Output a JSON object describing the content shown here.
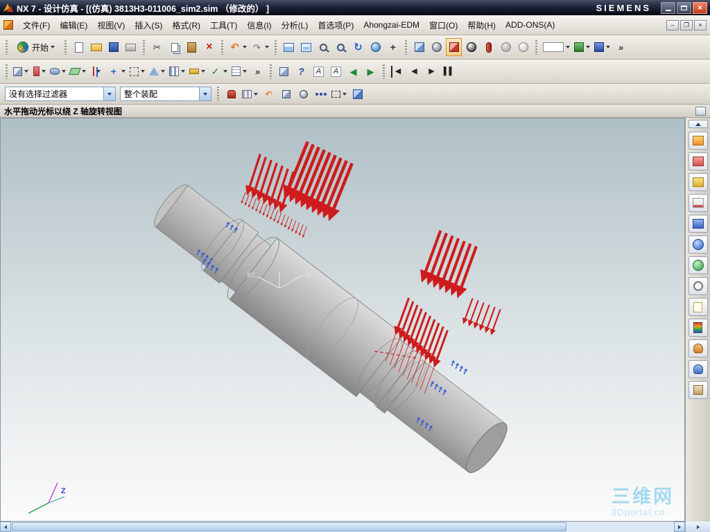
{
  "window": {
    "title": "NX 7 - 设计仿真 - [(仿真) 3813H3-011006_sim2.sim （修改的） ]",
    "brand": "SIEMENS"
  },
  "menubar": {
    "items": [
      "文件(F)",
      "编辑(E)",
      "视图(V)",
      "插入(S)",
      "格式(R)",
      "工具(T)",
      "信息(I)",
      "分析(L)",
      "首选项(P)",
      "Ahongzai-EDM",
      "窗口(O)",
      "帮助(H)",
      "ADD-ONS(A)"
    ]
  },
  "toolbar_standard": {
    "start_label": "开始",
    "icons": [
      {
        "name": "new-file-icon"
      },
      {
        "name": "open-icon"
      },
      {
        "name": "save-icon"
      },
      {
        "name": "print-icon"
      },
      {
        "name": "separator"
      },
      {
        "name": "cut-icon",
        "glyph": "✂"
      },
      {
        "name": "copy-icon"
      },
      {
        "name": "paste-icon"
      },
      {
        "name": "delete-icon",
        "glyph": "×"
      },
      {
        "name": "separator"
      },
      {
        "name": "undo-icon",
        "glyph": "↶",
        "dd": true
      },
      {
        "name": "repeat-command-icon",
        "glyph": "↷",
        "dd": true
      },
      {
        "name": "separator"
      },
      {
        "name": "window-layout-icon"
      },
      {
        "name": "fit-view-icon"
      },
      {
        "name": "zoom-icon"
      },
      {
        "name": "zoom-box-icon"
      },
      {
        "name": "refresh-icon",
        "glyph": "↻"
      },
      {
        "name": "rotate-view-icon"
      },
      {
        "name": "pan-view-icon",
        "glyph": "+"
      },
      {
        "name": "separator"
      },
      {
        "name": "shaded-cube-icon"
      },
      {
        "name": "wireframe-sphere-icon"
      },
      {
        "name": "analysis-cube-icon",
        "sel": true
      },
      {
        "name": "studio-sphere-icon"
      },
      {
        "name": "section-capsule-icon"
      },
      {
        "name": "gray-sphere-icon"
      },
      {
        "name": "light-sphere-icon"
      },
      {
        "name": "separator"
      },
      {
        "name": "view-style-box",
        "dd": true
      },
      {
        "name": "render-style-icon",
        "dd": true
      },
      {
        "name": "visualization-icon",
        "dd": true
      },
      {
        "name": "overflow-icon",
        "glyph": "»"
      }
    ]
  },
  "toolbar_view": {
    "icons": [
      {
        "name": "feature-cube-icon",
        "dd": true
      },
      {
        "name": "spray-icon",
        "dd": true
      },
      {
        "name": "swept-icon",
        "dd": true
      },
      {
        "name": "datum-plane-icon",
        "dd": true
      },
      {
        "name": "datum-axis-icon",
        "dd": true
      },
      {
        "name": "move-icon",
        "glyph": "+",
        "dd": true
      },
      {
        "name": "snap-icon",
        "dd": true
      },
      {
        "name": "triangle-icon",
        "dd": true
      },
      {
        "name": "pattern-icon",
        "dd": true
      },
      {
        "name": "measure-icon",
        "dd": true
      },
      {
        "name": "check-icon",
        "glyph": "✓",
        "dd": true
      },
      {
        "name": "list-icon",
        "dd": true
      },
      {
        "name": "overflow-icon",
        "glyph": "»"
      },
      {
        "name": "separator"
      },
      {
        "name": "mini-cube-icon"
      },
      {
        "name": "help-icon",
        "glyph": "?"
      },
      {
        "name": "text-a-icon",
        "glyph": "A"
      },
      {
        "name": "text-a2-icon",
        "glyph": "A"
      },
      {
        "name": "back-icon",
        "glyph": "◀"
      },
      {
        "name": "forward-icon",
        "glyph": "▶"
      },
      {
        "name": "separator"
      },
      {
        "name": "media-first-icon",
        "glyph": "◀"
      },
      {
        "name": "media-prev-icon",
        "glyph": "◀"
      },
      {
        "name": "media-play-icon",
        "glyph": "▶"
      },
      {
        "name": "media-pause-icon",
        "glyph": "▌▌"
      }
    ]
  },
  "selection_bar": {
    "filter_value": "没有选择过滤器",
    "scope_value": "整个装配",
    "icons": [
      {
        "name": "snap-magnet-icon"
      },
      {
        "name": "grid-edit-icon",
        "dd": true
      },
      {
        "name": "undo-small-icon",
        "glyph": "↶"
      },
      {
        "name": "shaded-mini-icon"
      },
      {
        "name": "wire-mini-icon"
      },
      {
        "name": "snap-point-icon"
      },
      {
        "name": "select-rect-icon",
        "dd": true
      },
      {
        "name": "cube-blue-icon"
      }
    ]
  },
  "prompt_bar": {
    "text": "水平拖动光标以绕 Z 轴旋转视图"
  },
  "viewport": {
    "wcs_label_z": "ZC",
    "wcs_label_x": "XC",
    "triad_label_z": "Z",
    "watermark_title": "三维网",
    "watermark_sub": "3Dportal.cn"
  },
  "resource_bar": {
    "icons": [
      {
        "name": "assembly-navigator-icon"
      },
      {
        "name": "constraint-navigator-icon"
      },
      {
        "name": "part-navigator-icon"
      },
      {
        "name": "reuse-library-icon"
      },
      {
        "name": "simulation-navigator-icon"
      },
      {
        "name": "web-browser-icon"
      },
      {
        "name": "materials-icon"
      },
      {
        "name": "history-icon"
      },
      {
        "name": "notes-icon"
      },
      {
        "name": "postprocess-icon"
      },
      {
        "name": "contacts-icon"
      },
      {
        "name": "roles-icon"
      },
      {
        "name": "touch-icon"
      }
    ]
  }
}
